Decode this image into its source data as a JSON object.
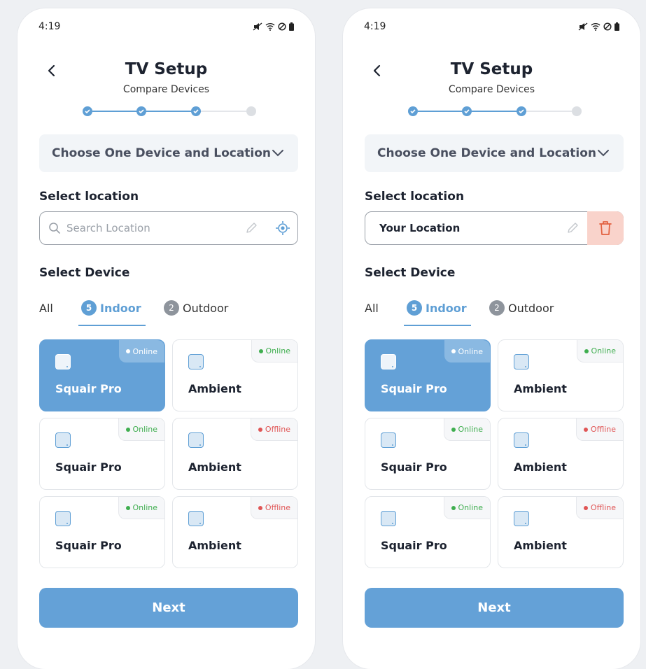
{
  "screens": [
    {
      "status_time": "4:19",
      "title": "TV Setup",
      "subtitle": "Compare Devices",
      "dropdown_label": "Choose One Device and Location",
      "location_label": "Select location",
      "location_placeholder": "Search Location",
      "location_value": "",
      "device_label": "Select Device",
      "tabs": [
        {
          "label": "All",
          "count": ""
        },
        {
          "label": "Indoor",
          "count": "5"
        },
        {
          "label": "Outdoor",
          "count": "2"
        }
      ],
      "devices": [
        {
          "name": "Squair Pro",
          "status": "Online",
          "selected": true
        },
        {
          "name": "Ambient",
          "status": "Online",
          "selected": false
        },
        {
          "name": "Squair Pro",
          "status": "Online",
          "selected": false
        },
        {
          "name": "Ambient",
          "status": "Offline",
          "selected": false
        },
        {
          "name": "Squair Pro",
          "status": "Online",
          "selected": false
        },
        {
          "name": "Ambient",
          "status": "Offline",
          "selected": false
        }
      ],
      "next_label": "Next"
    },
    {
      "status_time": "4:19",
      "title": "TV Setup",
      "subtitle": "Compare Devices",
      "dropdown_label": "Choose One Device and Location",
      "location_label": "Select location",
      "location_placeholder": "",
      "location_value": "Your Location",
      "device_label": "Select Device",
      "tabs": [
        {
          "label": "All",
          "count": ""
        },
        {
          "label": "Indoor",
          "count": "5"
        },
        {
          "label": "Outdoor",
          "count": "2"
        }
      ],
      "devices": [
        {
          "name": "Squair Pro",
          "status": "Online",
          "selected": true
        },
        {
          "name": "Ambient",
          "status": "Online",
          "selected": false
        },
        {
          "name": "Squair Pro",
          "status": "Online",
          "selected": false
        },
        {
          "name": "Ambient",
          "status": "Offline",
          "selected": false
        },
        {
          "name": "Squair Pro",
          "status": "Online",
          "selected": false
        },
        {
          "name": "Ambient",
          "status": "Offline",
          "selected": false
        }
      ],
      "next_label": "Next"
    }
  ],
  "colors": {
    "accent": "#64a1d7",
    "online": "#3fae4f",
    "offline": "#e05555",
    "delete_bg": "#f9d3cb"
  },
  "stepper": {
    "completed_steps": 3,
    "total_steps": 4
  }
}
